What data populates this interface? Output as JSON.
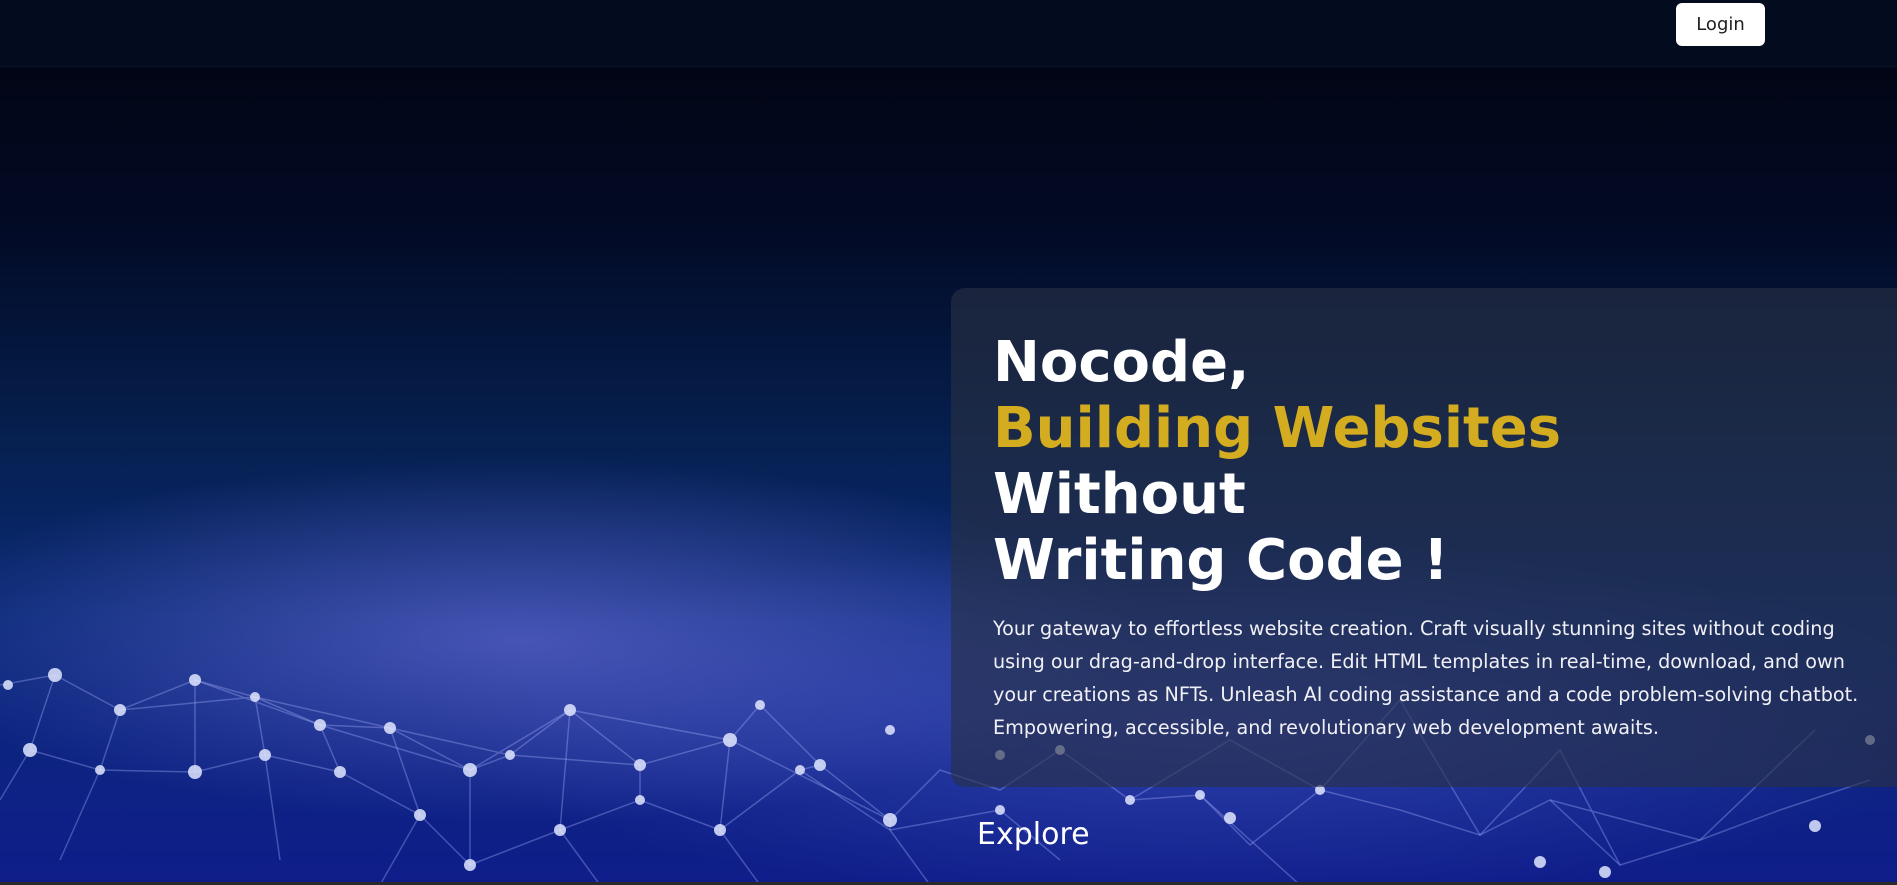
{
  "navbar": {
    "login_label": "Login"
  },
  "hero": {
    "headline_line1": "Nocode,",
    "headline_line2": "Building Websites",
    "headline_line3": "Without",
    "headline_line4": "Writing Code !",
    "description": "Your gateway to effortless website creation. Craft visually stunning sites without coding using our drag-and-drop interface. Edit HTML templates in real-time, download, and own your creations as NFTs. Unleash AI coding assistance and a code problem-solving chatbot. Empowering, accessible, and revolutionary web development awaits.",
    "explore_label": "Explore"
  },
  "colors": {
    "accent": "#d4ac20",
    "navbar_bg": "#030b1e",
    "text": "#ffffff"
  }
}
